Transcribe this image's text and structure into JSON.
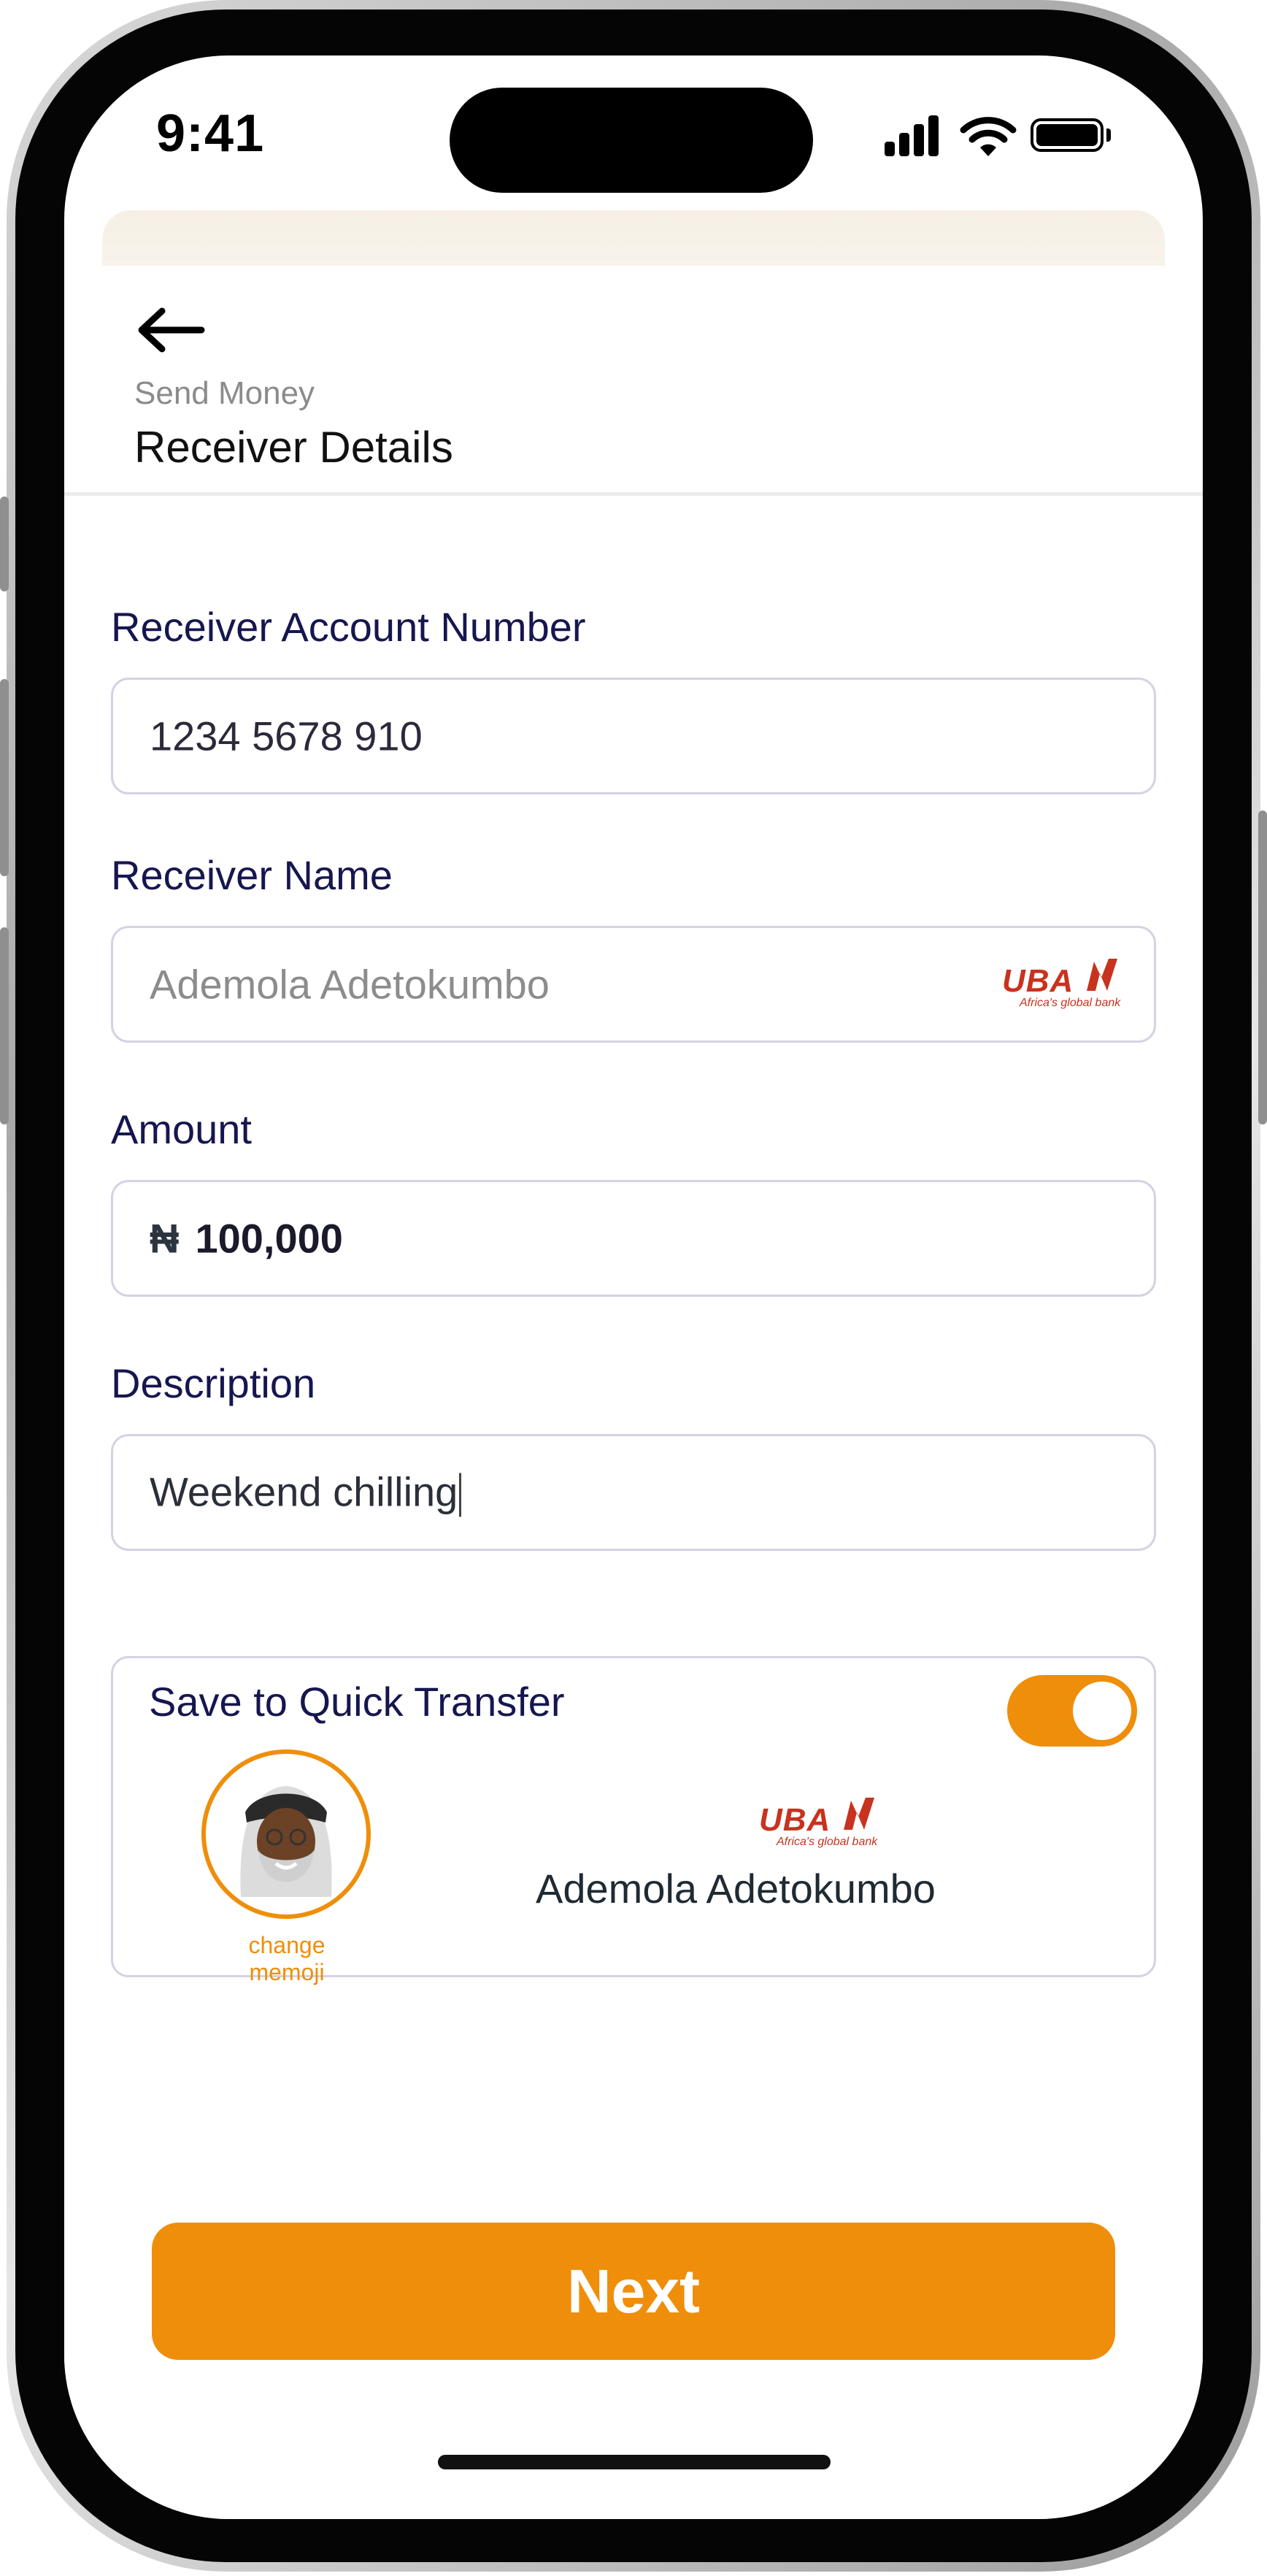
{
  "status_bar": {
    "time": "9:41"
  },
  "header": {
    "breadcrumb": "Send Money",
    "title": "Receiver Details"
  },
  "form": {
    "account_number": {
      "label": "Receiver Account Number",
      "value": "1234 5678 910"
    },
    "receiver_name": {
      "label": "Receiver Name",
      "value": "Ademola Adetokumbo"
    },
    "amount": {
      "label": "Amount",
      "currency_symbol": "₦",
      "value": "100,000"
    },
    "description": {
      "label": "Description",
      "value": "Weekend chilling"
    }
  },
  "bank": {
    "name": "UBA",
    "tagline": "Africa's global bank",
    "color": "#c8321e"
  },
  "quick_transfer": {
    "title": "Save to Quick Transfer",
    "toggle_on": true,
    "change_memoji": "change memoji",
    "receiver_name": "Ademola Adetokumbo"
  },
  "actions": {
    "next_label": "Next"
  },
  "colors": {
    "accent": "#ef8e0a",
    "label": "#16164f",
    "field_border": "#d3d3e3"
  }
}
